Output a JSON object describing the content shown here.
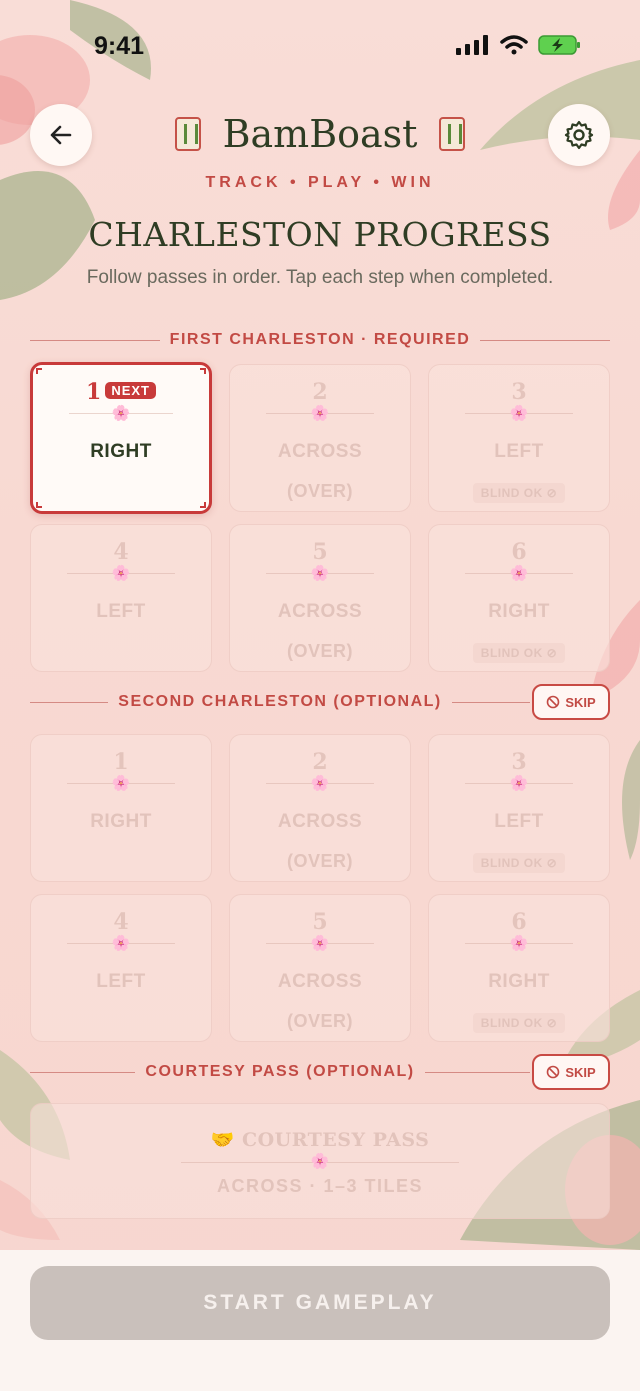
{
  "status_bar": {
    "time": "9:41"
  },
  "header": {
    "app_name": "BamBoast",
    "tagline": "TRACK • PLAY • WIN",
    "title": "CHARLESTON PROGRESS",
    "subtitle": "Follow passes in order. Tap each step when completed."
  },
  "first_charleston": {
    "label": "FIRST CHARLESTON · REQUIRED",
    "steps": [
      {
        "num": "1",
        "dir": "RIGHT",
        "badge": "NEXT"
      },
      {
        "num": "2",
        "dir": "ACROSS",
        "sub": "(OVER)"
      },
      {
        "num": "3",
        "dir": "LEFT",
        "blind": "BLIND OK"
      },
      {
        "num": "4",
        "dir": "LEFT"
      },
      {
        "num": "5",
        "dir": "ACROSS",
        "sub": "(OVER)"
      },
      {
        "num": "6",
        "dir": "RIGHT",
        "blind": "BLIND OK"
      }
    ]
  },
  "second_charleston": {
    "label": "SECOND CHARLESTON (OPTIONAL)",
    "skip_label": "SKIP",
    "steps": [
      {
        "num": "1",
        "dir": "RIGHT"
      },
      {
        "num": "2",
        "dir": "ACROSS",
        "sub": "(OVER)"
      },
      {
        "num": "3",
        "dir": "LEFT",
        "blind": "BLIND OK"
      },
      {
        "num": "4",
        "dir": "LEFT"
      },
      {
        "num": "5",
        "dir": "ACROSS",
        "sub": "(OVER)"
      },
      {
        "num": "6",
        "dir": "RIGHT",
        "blind": "BLIND OK"
      }
    ]
  },
  "courtesy": {
    "label": "COURTESY PASS (OPTIONAL)",
    "skip_label": "SKIP",
    "title": "COURTESY PASS",
    "sub": "ACROSS · 1–3 TILES"
  },
  "start_button": {
    "label": "START GAMEPLAY"
  },
  "colors": {
    "accent": "#c83a3a",
    "title": "#2f3d24",
    "background": "#f8d9d2"
  }
}
